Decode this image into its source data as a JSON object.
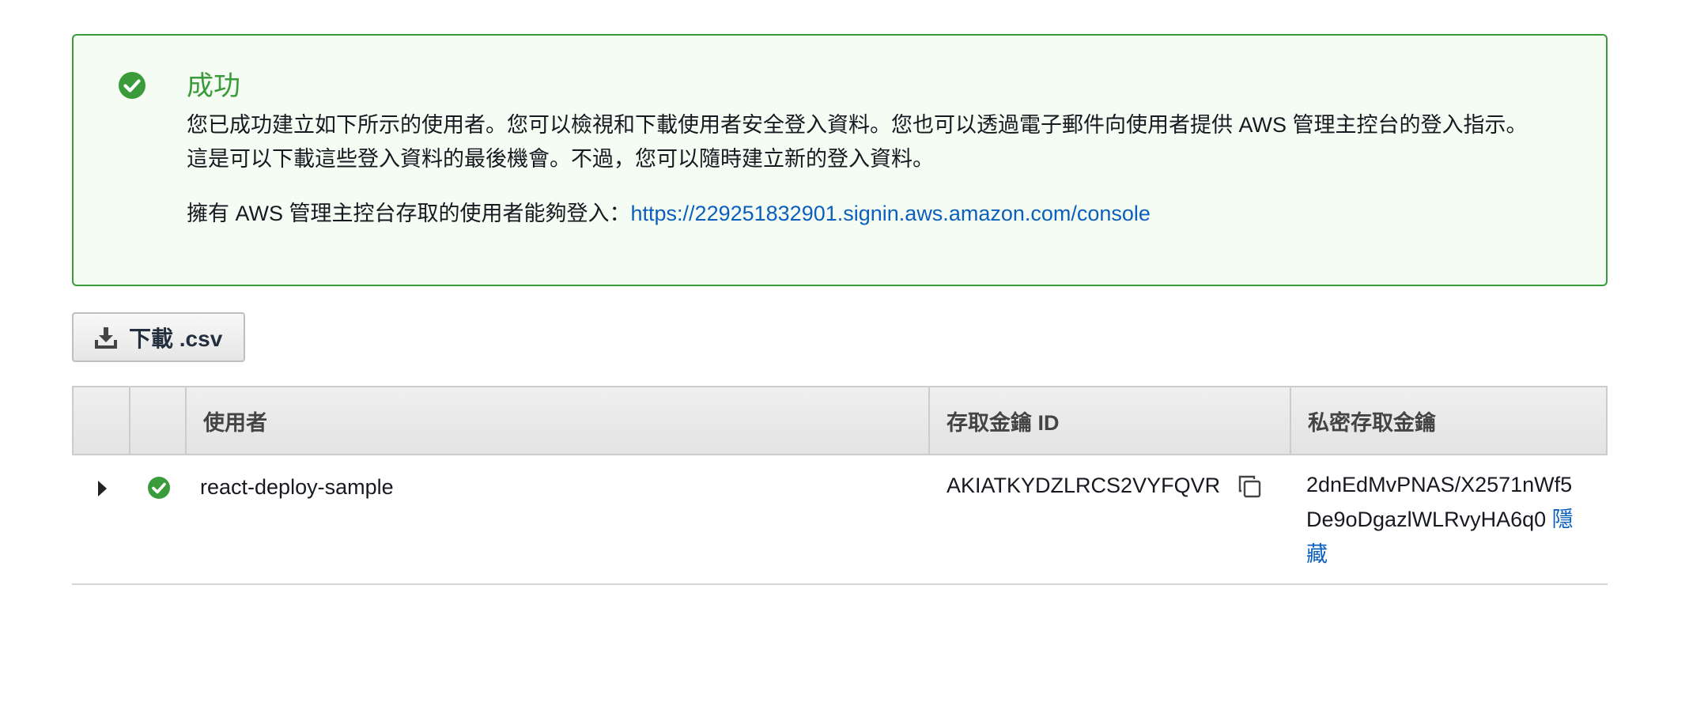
{
  "alert": {
    "title": "成功",
    "message": "您已成功建立如下所示的使用者。您可以檢視和下載使用者安全登入資料。您也可以透過電子郵件向使用者提供 AWS 管理主控台的登入指示。這是可以下載這些登入資料的最後機會。不過，您可以隨時建立新的登入資料。",
    "signin_prefix": "擁有 AWS 管理主控台存取的使用者能夠登入：",
    "signin_url": "https://229251832901.signin.aws.amazon.com/console",
    "icon": "check-circle-icon",
    "color": "#3a9b3a"
  },
  "toolbar": {
    "download_label": "下載 .csv",
    "download_icon": "download-icon"
  },
  "table": {
    "columns": {
      "user": "使用者",
      "access_key_id": "存取金鑰 ID",
      "secret_access_key": "私密存取金鑰"
    },
    "rows": [
      {
        "username": "react-deploy-sample",
        "access_key_id": "AKIATKYDZLRCS2VYFQVR",
        "secret_line1": "2dnEdMvPNAS/X2571nWf5",
        "secret_line2": "De9oDgazlWLRvyHA6q0",
        "hide_label": "隱藏",
        "status_icon": "check-circle-icon",
        "copy_icon": "copy-icon"
      }
    ]
  },
  "colors": {
    "success": "#3a9b3a",
    "link": "#0b5fbd"
  }
}
